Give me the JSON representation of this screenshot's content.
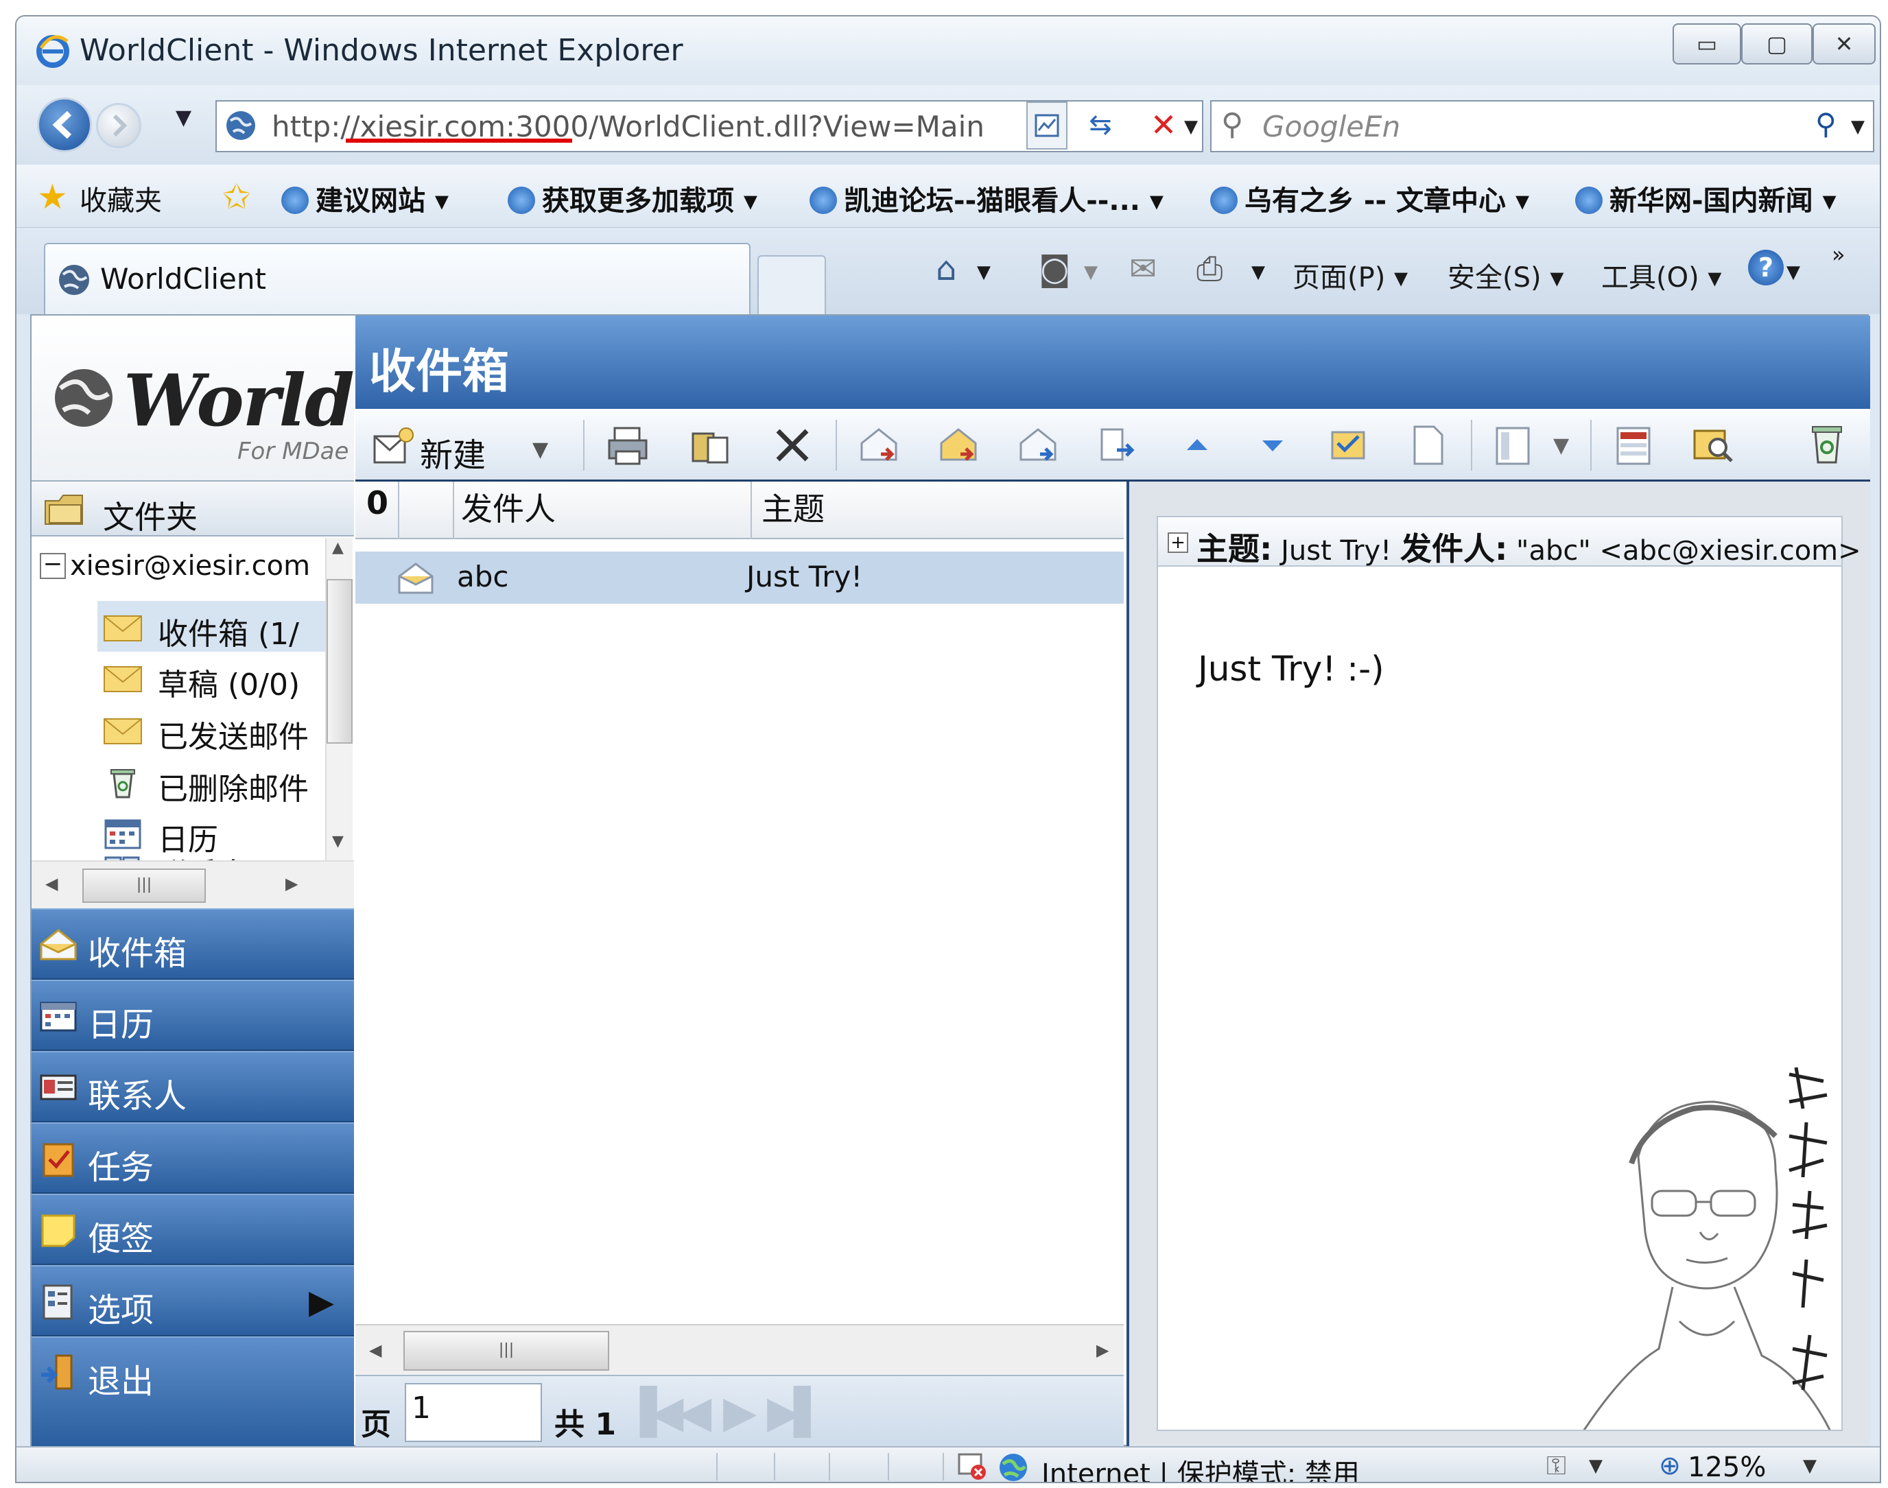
{
  "window": {
    "title": "WorldClient - Windows Internet Explorer",
    "controls": {
      "minimize": "▭",
      "maximize": "▢",
      "close": "✕"
    }
  },
  "address": {
    "url": "http://xiesir.com:3000/WorldClient.dll?View=Main",
    "highlight_color": "#e00000"
  },
  "search": {
    "placeholder": "GoogleEn"
  },
  "favorites": {
    "label": "收藏夹",
    "links": [
      "建议网站 ▾",
      "获取更多加载项 ▾",
      "凯迪论坛--猫眼看人--...  ▾",
      "乌有之乡 -- 文章中心 ▾",
      "新华网-国内新闻 ▾"
    ]
  },
  "tab": {
    "label": "WorldClient"
  },
  "command_bar": {
    "page": "页面(P) ▾",
    "safety": "安全(S) ▾",
    "tools": "工具(O) ▾",
    "chevron": "»"
  },
  "app": {
    "logo_text": "WorldCli",
    "logo_sub": "For MDae",
    "folder_header": "文件夹",
    "account": "xiesir@xiesir.com",
    "folders": [
      {
        "label": "收件箱 (1/",
        "icon": "envelope-icon"
      },
      {
        "label": "草稿 (0/0)",
        "icon": "envelope-icon"
      },
      {
        "label": "已发送邮件",
        "icon": "envelope-icon"
      },
      {
        "label": "已删除邮件",
        "icon": "trash-icon"
      },
      {
        "label": "日历",
        "icon": "calendar-icon"
      },
      {
        "label": "联系人",
        "icon": "contacts-icon"
      }
    ],
    "nav": [
      {
        "label": "收件箱",
        "icon": "inbox-icon"
      },
      {
        "label": "日历",
        "icon": "calendar-icon"
      },
      {
        "label": "联系人",
        "icon": "contacts-icon"
      },
      {
        "label": "任务",
        "icon": "tasks-icon"
      },
      {
        "label": "便签",
        "icon": "notes-icon"
      },
      {
        "label": "选项",
        "icon": "options-icon"
      },
      {
        "label": "退出",
        "icon": "logout-icon"
      }
    ],
    "folder_title": "收件箱",
    "toolbar": {
      "new_label": "新建"
    },
    "list": {
      "col_attach": "0",
      "col_from": "发件人",
      "col_subject": "主题",
      "messages": [
        {
          "from": "abc",
          "subject": "Just Try!"
        }
      ]
    },
    "pager": {
      "page_label": "页",
      "page_value": "1",
      "total_label": "共 1"
    },
    "preview": {
      "subject_label": "主题:",
      "subject": " Just Try! ",
      "from_label": "发件人:",
      "from": " \"abc\" <abc@xiesir.com>",
      "body": "Just Try! :-)"
    }
  },
  "status": {
    "zone": "Internet | 保护模式: 禁用",
    "zoom": "125%"
  },
  "colors": {
    "header_blue": "#2f63a8",
    "nav_blue": "#2b5e9e",
    "selected_row": "#c4d6ea"
  }
}
